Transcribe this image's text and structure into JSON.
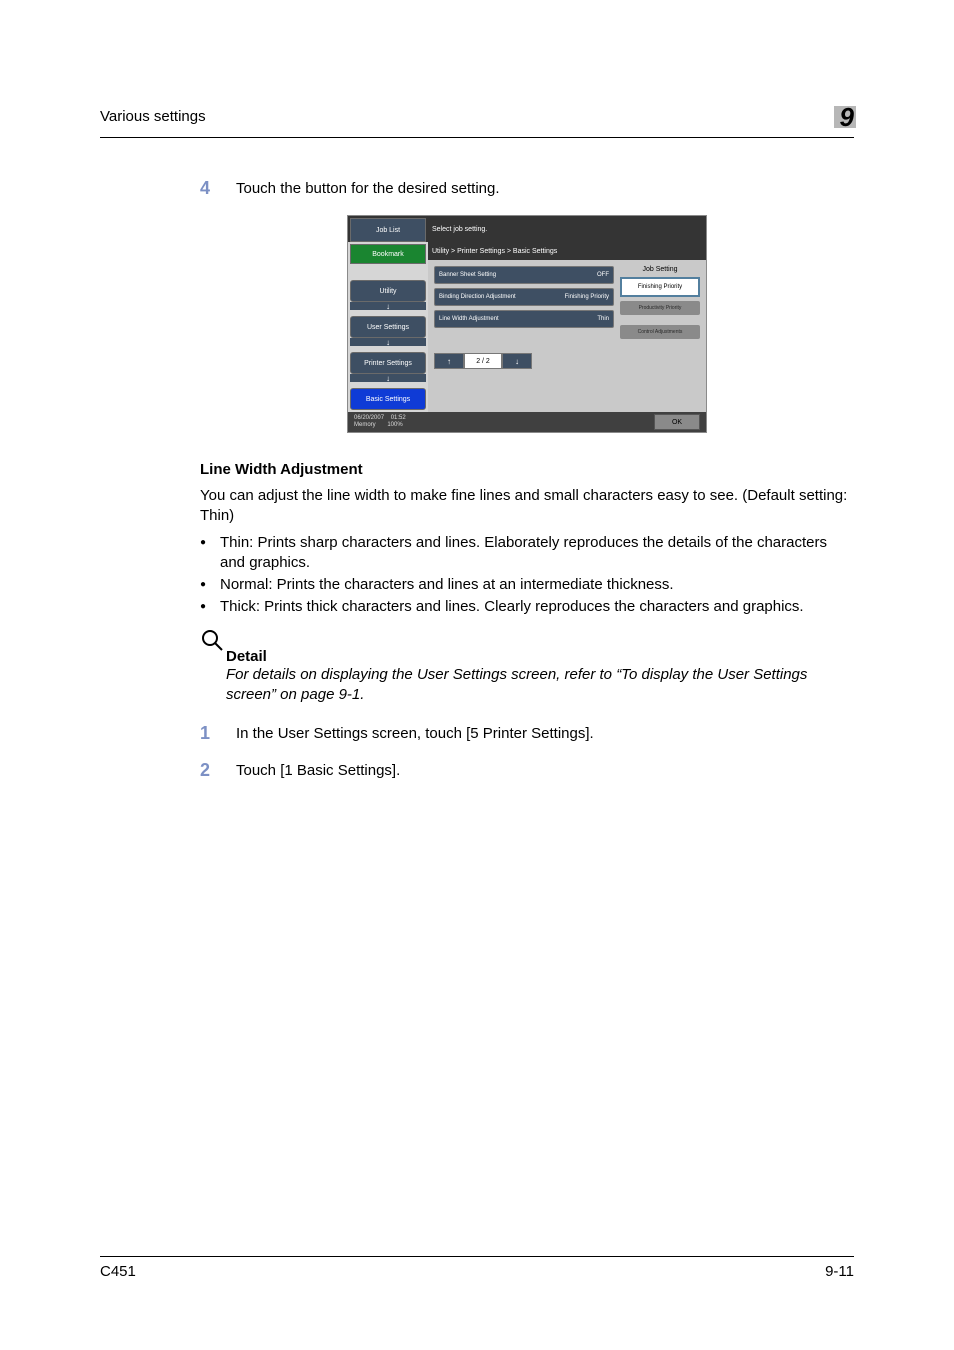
{
  "header": {
    "title": "Various settings",
    "chapter": "9"
  },
  "step4": {
    "num": "4",
    "text": "Touch the button for the desired setting."
  },
  "screenshot": {
    "job_list": "Job List",
    "top_instr": "Select job setting.",
    "bookmark": "Bookmark",
    "breadcrumb": "Utility > Printer Settings > Basic Settings",
    "side": {
      "utility": "Utility",
      "user": "User Settings",
      "printer": "Printer Settings",
      "basic": "Basic Settings"
    },
    "options": {
      "banner_label": "Banner Sheet Setting",
      "banner_value": "OFF",
      "binding_label": "Binding Direction Adjustment",
      "binding_value": "Finishing Priority",
      "line_label": "Line Width Adjustment",
      "line_value": "Thin"
    },
    "right": {
      "header": "Job Setting",
      "finishing": "Finishing Priority",
      "productivity": "Productivity\nPriority",
      "control": "Control\nAdjustments"
    },
    "pager": {
      "up": "↑",
      "indicator": "2 / 2",
      "down": "↓"
    },
    "footer": {
      "date": "06/20/2007",
      "time": "01:52",
      "mem_label": "Memory",
      "mem_val": "100%",
      "ok": "OK"
    }
  },
  "section": {
    "heading": "Line Width Adjustment",
    "intro": "You can adjust the line width to make fine lines and small characters easy to see. (Default setting: Thin)",
    "bullets": [
      "Thin: Prints sharp characters and lines. Elaborately reproduces the details of the characters and graphics.",
      "Normal: Prints the characters and lines at an intermediate thickness.",
      "Thick: Prints thick characters and lines. Clearly reproduces the characters and graphics."
    ]
  },
  "detail": {
    "title": "Detail",
    "text": "For details on displaying the User Settings screen, refer to “To display the User Settings screen” on page 9-1."
  },
  "step1": {
    "num": "1",
    "text": "In the User Settings screen, touch [5 Printer Settings]."
  },
  "step2": {
    "num": "2",
    "text": "Touch [1 Basic Settings]."
  },
  "footer_bar": {
    "model": "C451",
    "page": "9-11"
  }
}
